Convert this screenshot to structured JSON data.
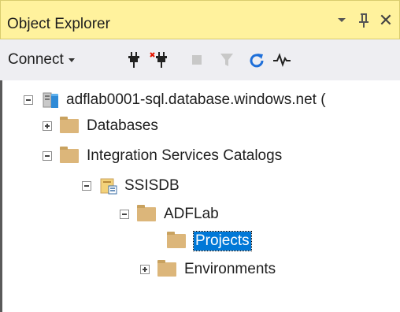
{
  "panel": {
    "title": "Object Explorer",
    "close_glyph": "✕"
  },
  "toolbar": {
    "connect_label": "Connect",
    "icons": [
      "connect-plug-icon",
      "disconnect-icon",
      "stop-icon",
      "filter-icon",
      "refresh-icon",
      "activity-monitor-icon"
    ]
  },
  "tree": {
    "server": {
      "label": "adflab0001-sql.database.windows.net (",
      "icon": "server-icon",
      "expanded": true
    },
    "databases": {
      "label": "Databases",
      "icon": "folder-icon",
      "expanded": false
    },
    "integration_services": {
      "label": "Integration Services Catalogs",
      "icon": "folder-icon",
      "expanded": true
    },
    "ssisdb": {
      "label": "SSISDB",
      "icon": "catalog-db-icon",
      "expanded": true
    },
    "adflab": {
      "label": "ADFLab",
      "icon": "folder-icon",
      "expanded": true
    },
    "projects": {
      "label": "Projects",
      "icon": "folder-icon",
      "selected": true
    },
    "environments": {
      "label": "Environments",
      "icon": "folder-icon",
      "expanded": false
    }
  },
  "colors": {
    "title_bar": "#fff29d",
    "toolbar": "#eeeef2",
    "folder": "#dcb67a",
    "selection": "#0078d7",
    "refresh_icon": "#1e6fd9",
    "disconnect_mark": "#e51400"
  }
}
